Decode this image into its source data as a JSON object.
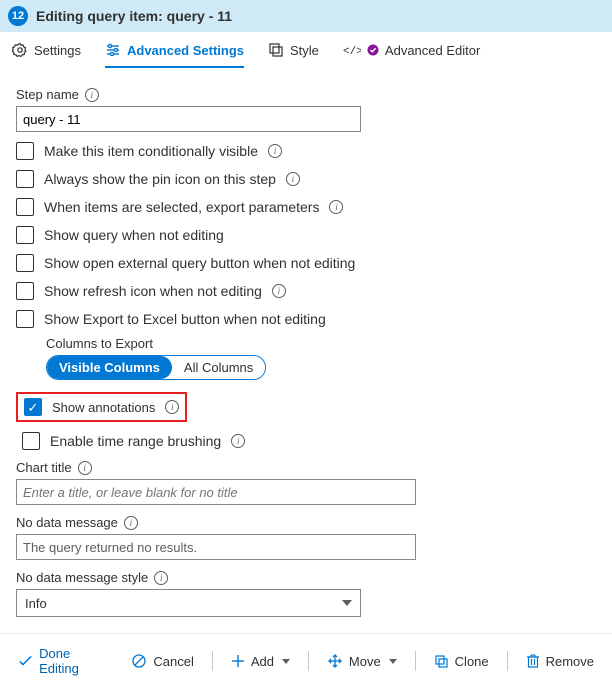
{
  "header": {
    "step_number": "12",
    "title": "Editing query item: query - 11"
  },
  "tabs": {
    "settings": "Settings",
    "advanced_settings": "Advanced Settings",
    "style": "Style",
    "advanced_editor": "Advanced Editor"
  },
  "form": {
    "step_name_label": "Step name",
    "step_name_value": "query - 11",
    "cb_conditional": "Make this item conditionally visible",
    "cb_pin": "Always show the pin icon on this step",
    "cb_export_params": "When items are selected, export parameters",
    "cb_show_query": "Show query when not editing",
    "cb_open_external": "Show open external query button when not editing",
    "cb_refresh": "Show refresh icon when not editing",
    "cb_export_excel": "Show Export to Excel button when not editing",
    "columns_to_export_label": "Columns to Export",
    "pill_visible": "Visible Columns",
    "pill_all": "All Columns",
    "cb_show_annotations": "Show annotations",
    "cb_time_brush": "Enable time range brushing",
    "chart_title_label": "Chart title",
    "chart_title_placeholder": "Enter a title, or leave blank for no title",
    "no_data_label": "No data message",
    "no_data_value": "The query returned no results.",
    "no_data_style_label": "No data message style",
    "no_data_style_value": "Info"
  },
  "toolbar": {
    "done": "Done Editing",
    "cancel": "Cancel",
    "add": "Add",
    "move": "Move",
    "clone": "Clone",
    "remove": "Remove"
  }
}
